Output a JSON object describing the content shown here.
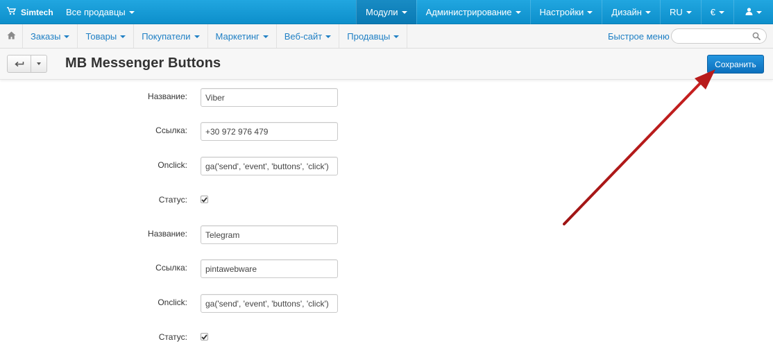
{
  "topbar": {
    "brand": "Simtech",
    "vendors_label": "Все продавцы",
    "menu": [
      {
        "label": "Модули",
        "active": true
      },
      {
        "label": "Администрирование",
        "active": false
      },
      {
        "label": "Настройки",
        "active": false
      },
      {
        "label": "Дизайн",
        "active": false
      },
      {
        "label": "RU",
        "active": false
      },
      {
        "label": "€",
        "active": false
      }
    ]
  },
  "nav": {
    "items": [
      "Заказы",
      "Товары",
      "Покупатели",
      "Маркетинг",
      "Веб-сайт",
      "Продавцы"
    ],
    "quick_menu": "Быстрое меню",
    "search_value": ""
  },
  "page": {
    "title": "MB Messenger Buttons",
    "save_label": "Сохранить"
  },
  "form": {
    "buttons": [
      {
        "name_label": "Название:",
        "name_value": "Viber",
        "link_label": "Ссылка:",
        "link_value": "+30 972 976 479",
        "onclick_label": "Onclick:",
        "onclick_value": "ga('send', 'event', 'buttons', 'click')",
        "status_label": "Статус:",
        "status_checked": true
      },
      {
        "name_label": "Название:",
        "name_value": "Telegram",
        "link_label": "Ссылка:",
        "link_value": "pintawebware",
        "onclick_label": "Onclick:",
        "onclick_value": "ga('send', 'event', 'buttons', 'click')",
        "status_label": "Статус:",
        "status_checked": true
      }
    ]
  },
  "colors": {
    "topbar": "#1a9bd7",
    "link": "#1e7fc4",
    "save_button": "#1979c6",
    "annotation_arrow": "#b81c1c"
  },
  "icons": {
    "brand": "cart-icon",
    "home": "home-icon",
    "search": "search-icon",
    "user": "user-icon",
    "back": "back-arrow-icon",
    "checkmark": "checkmark-icon"
  }
}
